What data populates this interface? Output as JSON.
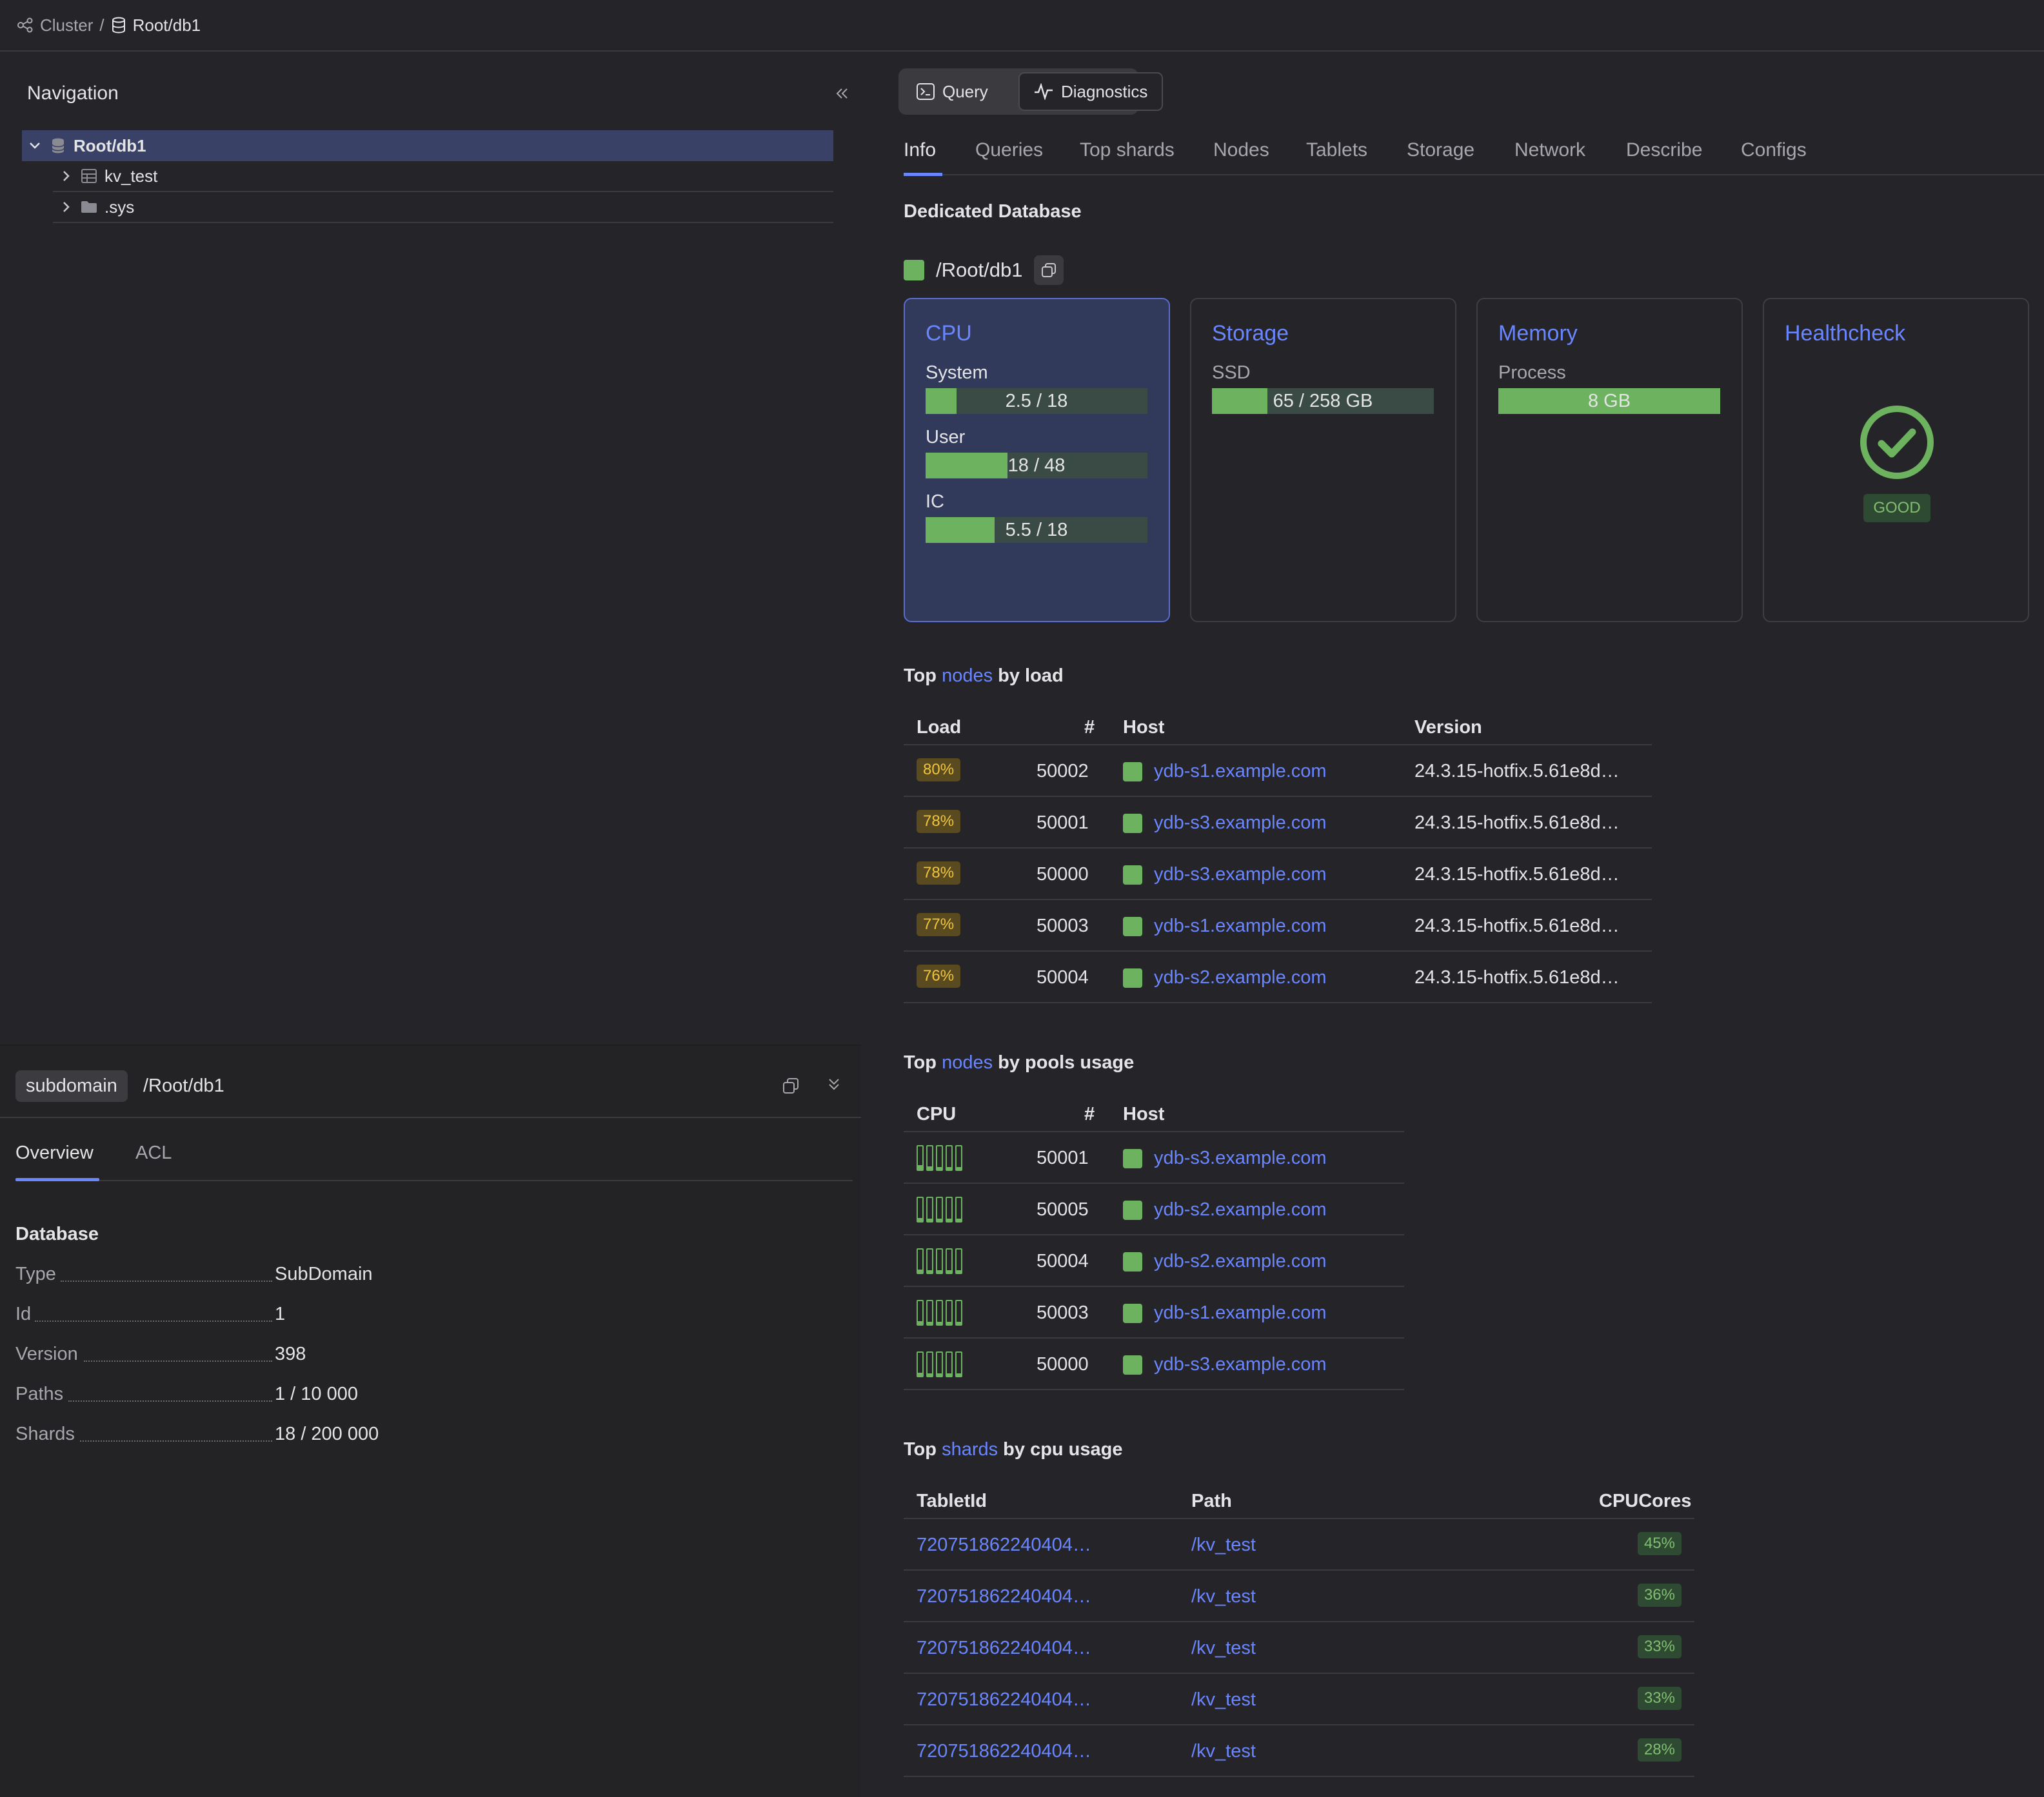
{
  "breadcrumb": {
    "cluster": "Cluster",
    "separator": "/",
    "database": "Root/db1"
  },
  "navigation": {
    "title": "Navigation",
    "tree": [
      {
        "label": "Root/db1",
        "icon": "database-icon"
      },
      {
        "label": "kv_test",
        "icon": "table-icon"
      },
      {
        "label": ".sys",
        "icon": "folder-icon"
      }
    ]
  },
  "summary": {
    "type_chip": "subdomain",
    "path": "/Root/db1",
    "tabs": [
      "Overview",
      "ACL"
    ],
    "section": "Database",
    "props": [
      {
        "k": "Type",
        "v": "SubDomain"
      },
      {
        "k": "Id",
        "v": "1"
      },
      {
        "k": "Version",
        "v": "398"
      },
      {
        "k": "Paths",
        "v": "1 / 10 000"
      },
      {
        "k": "Shards",
        "v": "18 / 200 000"
      }
    ]
  },
  "mode": {
    "query": "Query",
    "diagnostics": "Diagnostics"
  },
  "tabs": [
    "Info",
    "Queries",
    "Top shards",
    "Nodes",
    "Tablets",
    "Storage",
    "Network",
    "Describe",
    "Configs"
  ],
  "info": {
    "heading": "Dedicated Database",
    "db_path": "/Root/db1",
    "cards": {
      "cpu": {
        "title": "CPU",
        "metrics": [
          {
            "label": "System",
            "value": "2.5 / 18",
            "fraction": 0.14
          },
          {
            "label": "User",
            "value": "18 / 48",
            "fraction": 0.37
          },
          {
            "label": "IC",
            "value": "5.5 / 18",
            "fraction": 0.31
          }
        ]
      },
      "storage": {
        "title": "Storage",
        "metrics": [
          {
            "label": "SSD",
            "value": "65 / 258 GB",
            "fraction": 0.25
          }
        ]
      },
      "memory": {
        "title": "Memory",
        "metrics": [
          {
            "label": "Process",
            "value": "8 GB",
            "fraction": 1.0
          }
        ]
      },
      "health": {
        "title": "Healthcheck",
        "status": "GOOD"
      }
    },
    "top_nodes_load": {
      "pre": "Top",
      "link": "nodes",
      "post": "by load",
      "cols": [
        "Load",
        "#",
        "Host",
        "Version"
      ],
      "rows": [
        {
          "load": "80%",
          "id": "50002",
          "host": "ydb-s1.example.com",
          "version": "24.3.15-hotfix.5.61e8d…"
        },
        {
          "load": "78%",
          "id": "50001",
          "host": "ydb-s3.example.com",
          "version": "24.3.15-hotfix.5.61e8d…"
        },
        {
          "load": "78%",
          "id": "50000",
          "host": "ydb-s3.example.com",
          "version": "24.3.15-hotfix.5.61e8d…"
        },
        {
          "load": "77%",
          "id": "50003",
          "host": "ydb-s1.example.com",
          "version": "24.3.15-hotfix.5.61e8d…"
        },
        {
          "load": "76%",
          "id": "50004",
          "host": "ydb-s2.example.com",
          "version": "24.3.15-hotfix.5.61e8d…"
        }
      ]
    },
    "top_nodes_pools": {
      "pre": "Top",
      "link": "nodes",
      "post": "by pools usage",
      "cols": [
        "CPU",
        "#",
        "Host"
      ],
      "rows": [
        {
          "pools": [
            0.2,
            0.15,
            0.1,
            0.1,
            0.1
          ],
          "id": "50001",
          "host": "ydb-s3.example.com"
        },
        {
          "pools": [
            0.15,
            0.1,
            0.1,
            0.1,
            0.1
          ],
          "id": "50005",
          "host": "ydb-s2.example.com"
        },
        {
          "pools": [
            0.15,
            0.1,
            0.1,
            0.1,
            0.1
          ],
          "id": "50004",
          "host": "ydb-s2.example.com"
        },
        {
          "pools": [
            0.15,
            0.1,
            0.1,
            0.1,
            0.1
          ],
          "id": "50003",
          "host": "ydb-s1.example.com"
        },
        {
          "pools": [
            0.15,
            0.1,
            0.1,
            0.1,
            0.1
          ],
          "id": "50000",
          "host": "ydb-s3.example.com"
        }
      ]
    },
    "top_shards": {
      "pre": "Top",
      "link": "shards",
      "post": "by cpu usage",
      "cols": [
        "TabletId",
        "Path",
        "CPUCores"
      ],
      "rows": [
        {
          "tablet": "720751862240404…",
          "path": "/kv_test",
          "cpu": "45%"
        },
        {
          "tablet": "720751862240404…",
          "path": "/kv_test",
          "cpu": "36%"
        },
        {
          "tablet": "720751862240404…",
          "path": "/kv_test",
          "cpu": "33%"
        },
        {
          "tablet": "720751862240404…",
          "path": "/kv_test",
          "cpu": "33%"
        },
        {
          "tablet": "720751862240404…",
          "path": "/kv_test",
          "cpu": "28%"
        }
      ]
    }
  },
  "colors": {
    "accent": "#6a86ff",
    "ok": "#6db35f",
    "warn": "#f0c43c"
  }
}
